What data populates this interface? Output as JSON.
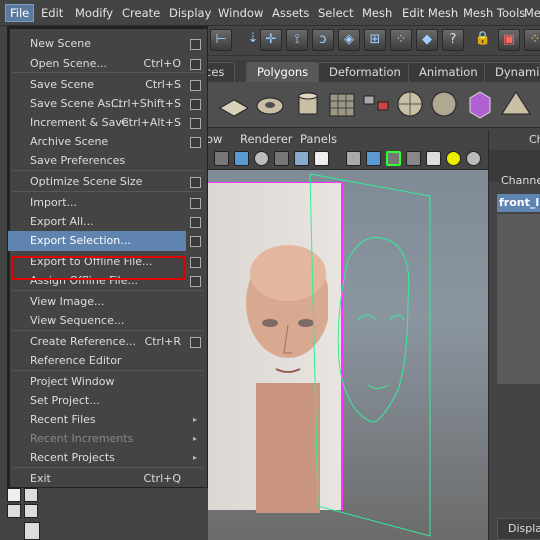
{
  "menubar": {
    "items": [
      "File",
      "Edit",
      "Modify",
      "Create",
      "Display",
      "Window",
      "Assets",
      "Select",
      "Mesh",
      "Edit Mesh",
      "Mesh Tools",
      "Me"
    ]
  },
  "shelf": {
    "tabs": [
      "ces",
      "Polygons",
      "Deformation",
      "Animation",
      "Dynamics"
    ]
  },
  "panel": {
    "menus": [
      "ow",
      "Renderer",
      "Panels"
    ]
  },
  "channel_box": {
    "header": "Ch",
    "label": "Channel",
    "object": "front_li",
    "bottom_tab": "Display"
  },
  "file_menu": {
    "items": [
      {
        "label": "New Scene",
        "shortcut": "",
        "option": true,
        "arrow": false,
        "disabled": false
      },
      {
        "label": "Open Scene...",
        "shortcut": "Ctrl+O",
        "option": true,
        "arrow": false,
        "disabled": false
      },
      {
        "label": "Save Scene",
        "shortcut": "Ctrl+S",
        "option": true,
        "arrow": false,
        "disabled": false
      },
      {
        "label": "Save Scene As...",
        "shortcut": "Ctrl+Shift+S",
        "option": true,
        "arrow": false,
        "disabled": false
      },
      {
        "label": "Increment & Save",
        "shortcut": "Ctrl+Alt+S",
        "option": true,
        "arrow": false,
        "disabled": false
      },
      {
        "label": "Archive Scene",
        "shortcut": "",
        "option": true,
        "arrow": false,
        "disabled": false
      },
      {
        "label": "Save Preferences",
        "shortcut": "",
        "option": false,
        "arrow": false,
        "disabled": false
      },
      {
        "label": "Optimize Scene Size",
        "shortcut": "",
        "option": true,
        "arrow": false,
        "disabled": false
      },
      {
        "label": "Import...",
        "shortcut": "",
        "option": true,
        "arrow": false,
        "disabled": false
      },
      {
        "label": "Export All...",
        "shortcut": "",
        "option": true,
        "arrow": false,
        "disabled": false
      },
      {
        "label": "Export Selection...",
        "shortcut": "",
        "option": true,
        "arrow": false,
        "disabled": false
      },
      {
        "label": "Export to Offline File...",
        "shortcut": "",
        "option": true,
        "arrow": false,
        "disabled": false
      },
      {
        "label": "Assign Offline File...",
        "shortcut": "",
        "option": true,
        "arrow": false,
        "disabled": false
      },
      {
        "label": "View Image...",
        "shortcut": "",
        "option": false,
        "arrow": false,
        "disabled": false
      },
      {
        "label": "View Sequence...",
        "shortcut": "",
        "option": false,
        "arrow": false,
        "disabled": false
      },
      {
        "label": "Create Reference...",
        "shortcut": "Ctrl+R",
        "option": true,
        "arrow": false,
        "disabled": false
      },
      {
        "label": "Reference Editor",
        "shortcut": "",
        "option": false,
        "arrow": false,
        "disabled": false
      },
      {
        "label": "Project Window",
        "shortcut": "",
        "option": false,
        "arrow": false,
        "disabled": false
      },
      {
        "label": "Set Project...",
        "shortcut": "",
        "option": false,
        "arrow": false,
        "disabled": false
      },
      {
        "label": "Recent Files",
        "shortcut": "",
        "option": false,
        "arrow": true,
        "disabled": false
      },
      {
        "label": "Recent Increments",
        "shortcut": "",
        "option": false,
        "arrow": true,
        "disabled": true
      },
      {
        "label": "Recent Projects",
        "shortcut": "",
        "option": false,
        "arrow": true,
        "disabled": false
      },
      {
        "label": "Exit",
        "shortcut": "Ctrl+Q",
        "option": false,
        "arrow": false,
        "disabled": false
      }
    ],
    "highlighted": "Export Selection..."
  },
  "colors": {
    "highlight": "#5f84b0",
    "callout": "#e00000",
    "image_plane_border": "#ff33ff",
    "sketch_lines": "#33ee99"
  }
}
